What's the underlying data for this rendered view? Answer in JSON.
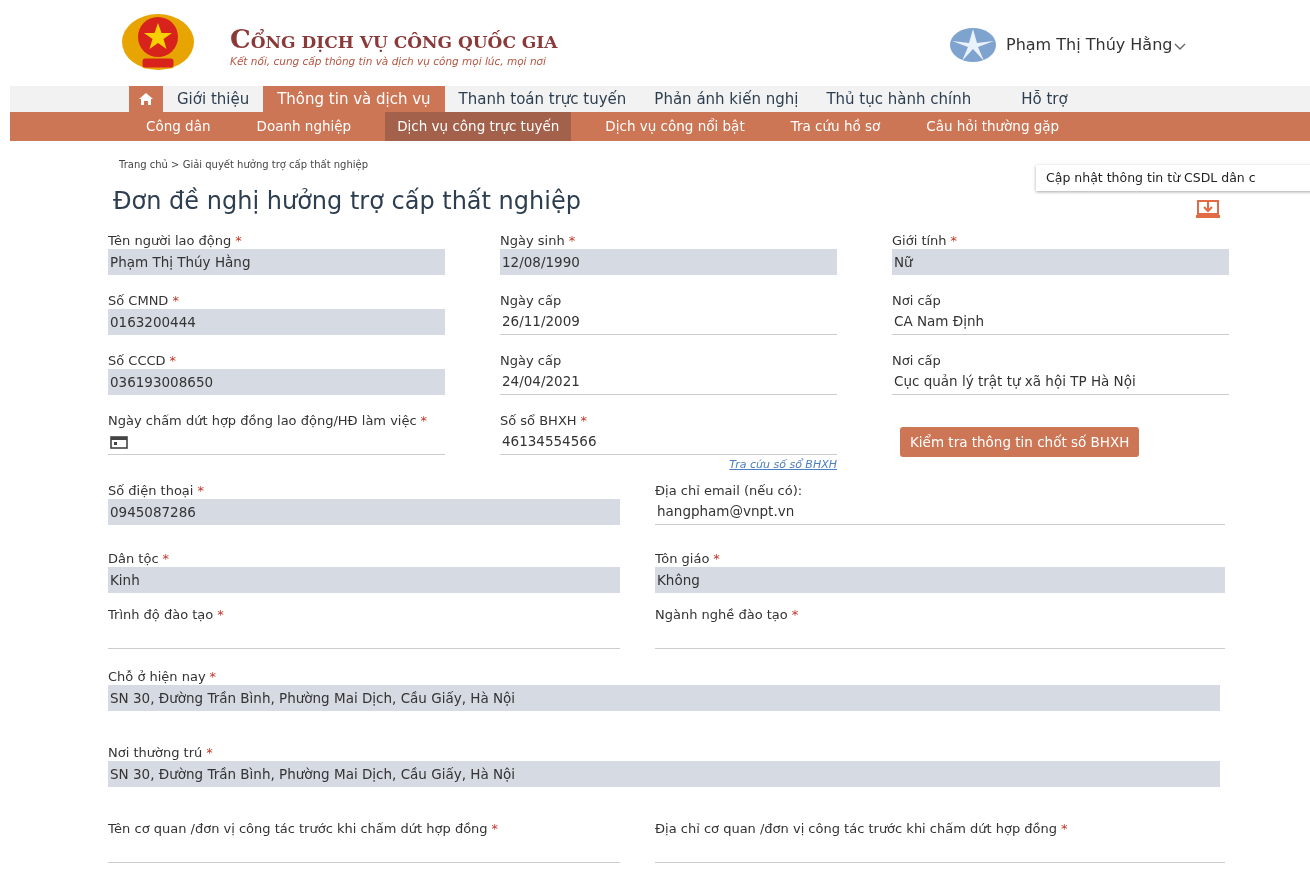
{
  "header": {
    "title": "CỔNG DỊCH VỤ CÔNG QUỐC GIA",
    "subtitle": "Kết nối, cung cấp thông tin và dịch vụ công mọi lúc, mọi nơi",
    "user_name": "Phạm Thị Thúy Hằng"
  },
  "nav": [
    {
      "label": "Giới thiệu",
      "selected": false
    },
    {
      "label": "Thông tin và dịch vụ",
      "selected": true
    },
    {
      "label": "Thanh toán trực tuyến",
      "selected": false
    },
    {
      "label": "Phản ánh kiến nghị",
      "selected": false
    },
    {
      "label": "Thủ tục hành chính",
      "selected": false
    },
    {
      "label": "Hỗ trợ",
      "selected": false
    }
  ],
  "subnav": [
    {
      "label": "Công dân",
      "selected": false
    },
    {
      "label": "Doanh nghiệp",
      "selected": false
    },
    {
      "label": "Dịch vụ công trực tuyến",
      "selected": true
    },
    {
      "label": "Dịch vụ công nổi bật",
      "selected": false
    },
    {
      "label": "Tra cứu hồ sơ",
      "selected": false
    },
    {
      "label": "Câu hỏi thường gặp",
      "selected": false
    }
  ],
  "breadcrumb": "Trang chủ > Giải quyết hưởng trợ cấp thất nghiệp",
  "tooltip": "Cập nhật thông tin từ CSDL dân c",
  "form_title": "Đơn đề nghị hưởng trợ cấp thất nghiệp",
  "rows": [
    {
      "fields": [
        {
          "label": "Tên người lao động",
          "required_mark": "*",
          "value": "Phạm Thị Thúy Hằng",
          "kind": "filled"
        },
        {
          "label": "Ngày sinh",
          "required_mark": "*",
          "value": "12/08/1990",
          "kind": "filled"
        },
        {
          "label": "Giới tính",
          "required_mark": "*",
          "value": "Nữ",
          "kind": "filled"
        }
      ]
    },
    {
      "fields": [
        {
          "label": "Số CMND",
          "required_mark": "*",
          "value": "0163200444",
          "kind": "filled"
        },
        {
          "label": "Ngày cấp",
          "value": "26/11/2009",
          "kind": "underline"
        },
        {
          "label": "Nơi cấp",
          "value": "CA Nam Định",
          "kind": "underline"
        }
      ]
    },
    {
      "fields": [
        {
          "label": "Số CCCD",
          "required_mark": "*",
          "value": "036193008650",
          "kind": "filled"
        },
        {
          "label": "Ngày cấp",
          "value": "24/04/2021",
          "kind": "underline"
        },
        {
          "label": "Nơi cấp",
          "value": "Cục quản lý trật tự xã hội TP Hà Nội",
          "kind": "underline"
        }
      ]
    },
    {
      "fields": [
        {
          "label": "Ngày chấm dứt hợp đồng lao động/HĐ làm việc",
          "required_mark": "*",
          "kind": "date"
        },
        {
          "label": "Số sổ BHXH",
          "required_mark": "*",
          "value": "46134554566",
          "kind": "underline",
          "link": "Tra cứu số sổ BHXH"
        },
        {
          "kind": "button",
          "button": "Kiểm tra thông tin chốt số BHXH"
        }
      ]
    },
    {
      "fields": [
        {
          "label": "Số điện thoại",
          "required_mark": "*",
          "value": "0945087286",
          "kind": "filled"
        },
        {
          "label": "Địa chỉ email (nếu có):",
          "value": "hangpham@vnpt.vn",
          "kind": "underline"
        }
      ]
    },
    {
      "fields": [
        {
          "label": "Dân tộc",
          "required_mark": "*",
          "value": "Kinh",
          "kind": "filled"
        },
        {
          "label": "Tôn giáo",
          "required_mark": "*",
          "value": "Không",
          "kind": "filled"
        }
      ]
    },
    {
      "fields": [
        {
          "label": "Trình độ đào tạo",
          "required_mark": "*",
          "kind": "underline"
        },
        {
          "label": "Ngành nghề đào tạo",
          "required_mark": "*",
          "kind": "underline"
        }
      ]
    },
    {
      "fields": [
        {
          "label": "Chỗ ở hiện nay",
          "required_mark": "*",
          "value": "SN 30, Đường Trần Bình, Phường Mai Dịch, Cầu Giấy, Hà Nội",
          "kind": "filled"
        }
      ]
    },
    {
      "fields": [
        {
          "label": "Nơi thường trú",
          "required_mark": "*",
          "value": "SN 30, Đường Trần Bình, Phường Mai Dịch, Cầu Giấy, Hà Nội",
          "kind": "filled"
        }
      ]
    },
    {
      "fields": [
        {
          "label": "Tên cơ quan /đơn vị công tác trước khi chấm dứt hợp đồng",
          "required_mark": "*",
          "kind": "underline"
        },
        {
          "label": "Địa chỉ cơ quan /đơn vị công tác trước khi chấm dứt hợp đồng",
          "required_mark": "*",
          "kind": "underline"
        }
      ]
    }
  ]
}
